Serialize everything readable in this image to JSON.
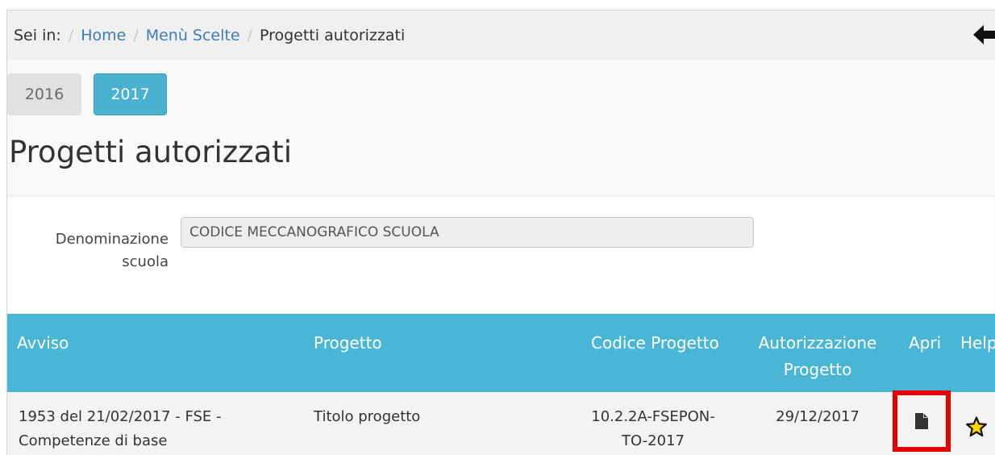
{
  "breadcrumb": {
    "prefix": "Sei in:",
    "items": [
      "Home",
      "Menù Scelte"
    ],
    "current": "Progetti autorizzati",
    "separator": "/"
  },
  "year_tabs": [
    {
      "label": "2016",
      "active": false
    },
    {
      "label": "2017",
      "active": true
    }
  ],
  "page_title": "Progetti autorizzati",
  "form": {
    "label": "Denominazione scuola",
    "value": "CODICE MECCANOGRAFICO SCUOLA"
  },
  "table": {
    "headers": {
      "avviso": "Avviso",
      "progetto": "Progetto",
      "codice": "Codice Progetto",
      "autorizzazione_line1": "Autorizzazione",
      "autorizzazione_line2": "Progetto",
      "apri": "Apri",
      "help": "Help"
    },
    "rows": [
      {
        "avviso_line1": "1953 del 21/02/2017 - FSE -",
        "avviso_line2": "Competenze di base",
        "progetto": "Titolo progetto",
        "codice_line1": "10.2.2A-FSEPON-",
        "codice_line2": "TO-2017",
        "autorizzazione": "29/12/2017",
        "apri_icon": "document-icon",
        "help_icon": "star-icon"
      }
    ]
  },
  "colors": {
    "accent": "#4ab6d6",
    "highlight": "#e60000",
    "link": "#3d7cb8"
  }
}
